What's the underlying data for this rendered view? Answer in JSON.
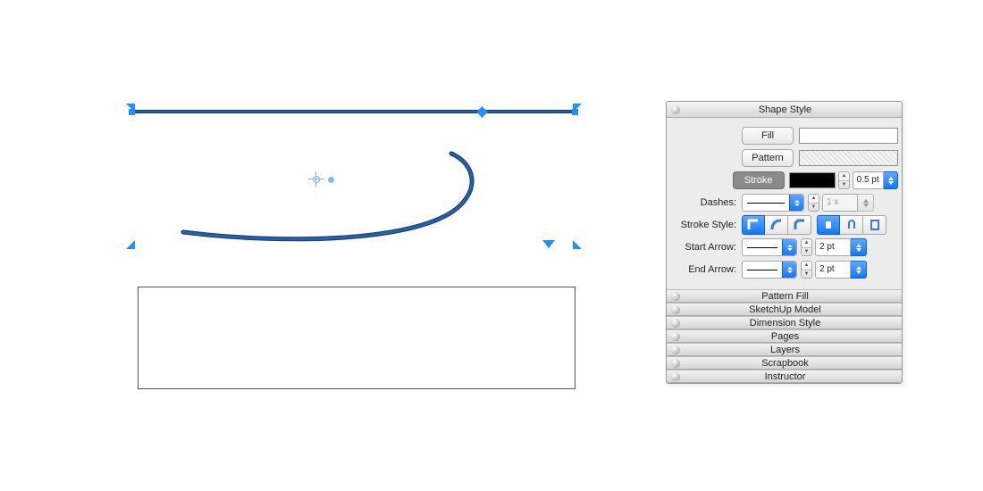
{
  "panel": {
    "title": "Shape Style",
    "fill_label": "Fill",
    "pattern_label": "Pattern",
    "stroke_label": "Stroke",
    "stroke_width": "0.5 pt",
    "dashes_label": "Dashes:",
    "dashes_multiplier": "1 x",
    "stroke_style_label": "Stroke Style:",
    "start_arrow_label": "Start Arrow:",
    "start_arrow_size": "2 pt",
    "end_arrow_label": "End Arrow:",
    "end_arrow_size": "2 pt"
  },
  "sections": {
    "pattern_fill": "Pattern Fill",
    "sketchup": "SketchUp Model",
    "dimension": "Dimension Style",
    "pages": "Pages",
    "layers": "Layers",
    "scrapbook": "Scrapbook",
    "instructor": "Instructor"
  }
}
